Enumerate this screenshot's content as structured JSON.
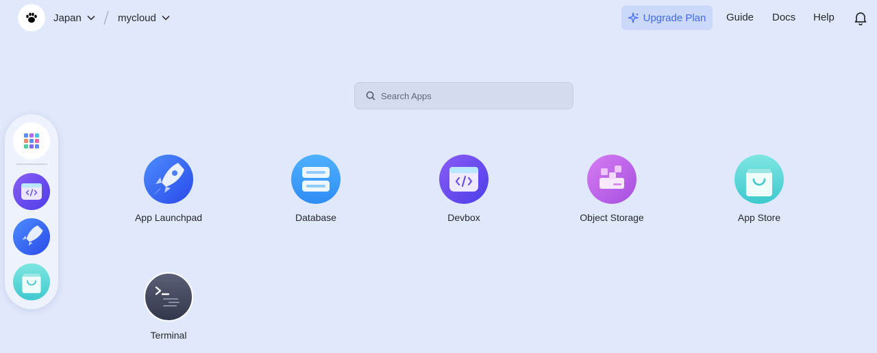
{
  "header": {
    "region": "Japan",
    "workspace": "mycloud",
    "upgrade_label": "Upgrade Plan",
    "links": [
      "Guide",
      "Docs",
      "Help"
    ]
  },
  "search": {
    "placeholder": "Search Apps"
  },
  "dock": {
    "items": [
      "apps-grid-icon",
      "devbox-icon",
      "app-launchpad-icon",
      "app-store-icon"
    ]
  },
  "apps": [
    {
      "label": "App Launchpad",
      "icon": "rocket-icon"
    },
    {
      "label": "Database",
      "icon": "database-icon"
    },
    {
      "label": "Devbox",
      "icon": "devbox-icon"
    },
    {
      "label": "Object Storage",
      "icon": "object-storage-icon"
    },
    {
      "label": "App Store",
      "icon": "shopping-bag-icon"
    },
    {
      "label": "Terminal",
      "icon": "terminal-icon"
    }
  ],
  "colors": {
    "background": "#e0e8fb",
    "accent": "#3e6af4",
    "upgrade_bg": "#cbd8fa"
  }
}
